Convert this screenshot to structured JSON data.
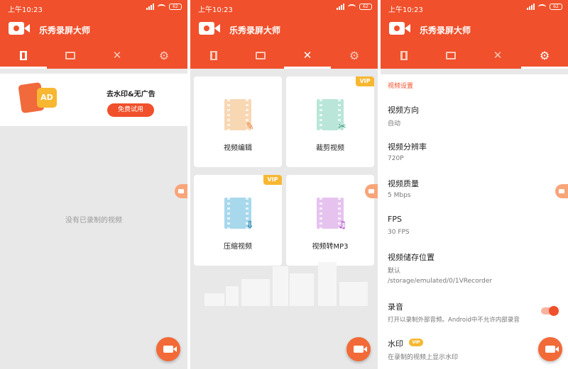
{
  "status": {
    "time": "上午10:23",
    "battery": "62"
  },
  "app": {
    "title": "乐秀录屏大师"
  },
  "tabs": [
    {
      "name": "video-list",
      "icon": "film-icon"
    },
    {
      "name": "gallery",
      "icon": "image-icon"
    },
    {
      "name": "tools",
      "icon": "tools-icon"
    },
    {
      "name": "settings",
      "icon": "gear-icon"
    }
  ],
  "screen1": {
    "promo": {
      "ad_badge": "AD",
      "title": "去水印&无广告",
      "button": "免费试用"
    },
    "empty_text": "没有已录制的视频"
  },
  "screen2": {
    "tools": [
      {
        "label": "视频编辑",
        "vip": ""
      },
      {
        "label": "裁剪视频",
        "vip": "VIP"
      },
      {
        "label": "压缩视频",
        "vip": "VIP"
      },
      {
        "label": "视频转MP3",
        "vip": ""
      }
    ]
  },
  "screen3": {
    "section": "视频设置",
    "orientation": {
      "title": "视频方向",
      "value": "自动"
    },
    "resolution": {
      "title": "视频分辨率",
      "value": "720P"
    },
    "quality": {
      "title": "视频质量",
      "value": "5 Mbps"
    },
    "fps": {
      "title": "FPS",
      "value": "30 FPS"
    },
    "storage": {
      "title": "视频储存位置",
      "value": "默认",
      "path": "/storage/emulated/0/1VRecorder"
    },
    "audio": {
      "title": "录音",
      "desc": "打开以录制外部音频。Android中不允许内部录音",
      "enabled": true
    },
    "watermark": {
      "title": "水印",
      "vip": "VIP",
      "desc": "在录制的视频上显示水印"
    }
  },
  "colors": {
    "primary": "#f0502b",
    "vip": "#f7b731",
    "fab": "#f26a37"
  }
}
